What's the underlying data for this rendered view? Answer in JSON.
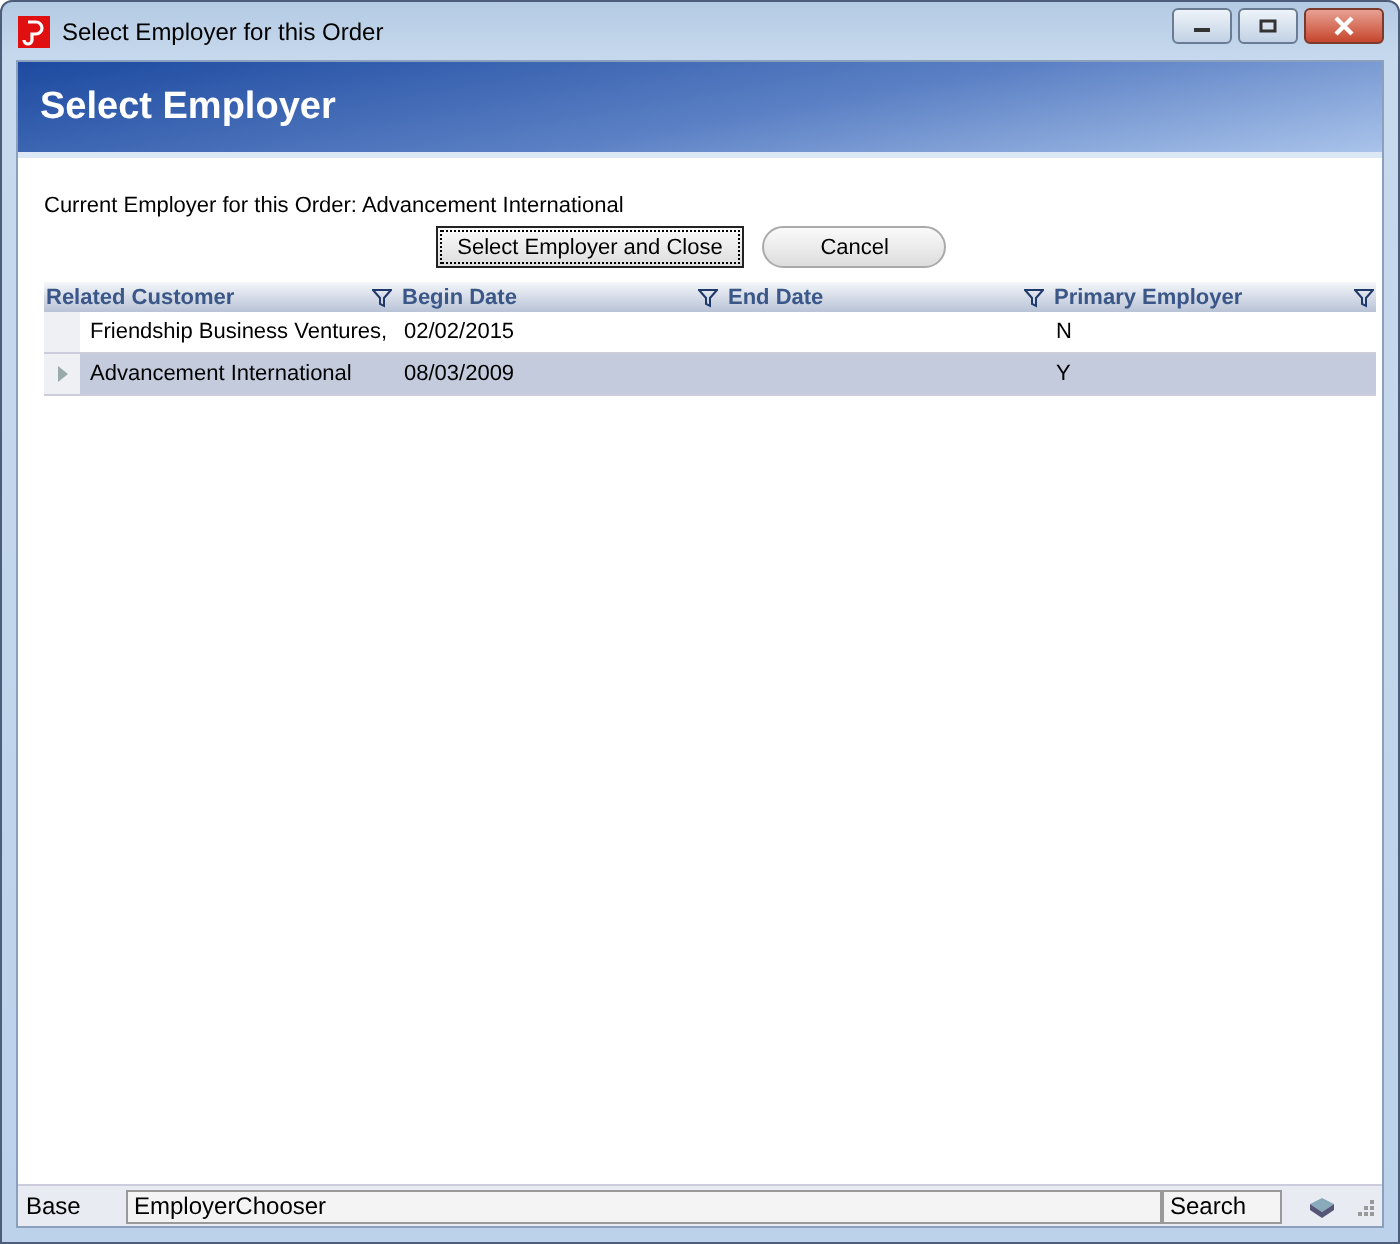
{
  "window": {
    "title": "Select Employer for this Order"
  },
  "header": {
    "title": "Select Employer"
  },
  "current_employer": "Current Employer for this Order: Advancement International",
  "buttons": [
    {
      "label": "Select Employer and Close",
      "focused": true
    },
    {
      "label": "Cancel",
      "focused": false
    }
  ],
  "table": {
    "columns": [
      "Related Customer",
      "Begin Date",
      "End Date",
      "Primary Employer"
    ],
    "rows": [
      {
        "cells": [
          "Friendship Business Ventures,",
          "02/02/2015",
          "",
          "N"
        ],
        "selected": false
      },
      {
        "cells": [
          "Advancement International",
          "08/03/2009",
          "",
          "Y"
        ],
        "selected": true
      }
    ]
  },
  "status_bar": {
    "label": "Base",
    "form_name": "EmployerChooser",
    "search": "Search"
  }
}
